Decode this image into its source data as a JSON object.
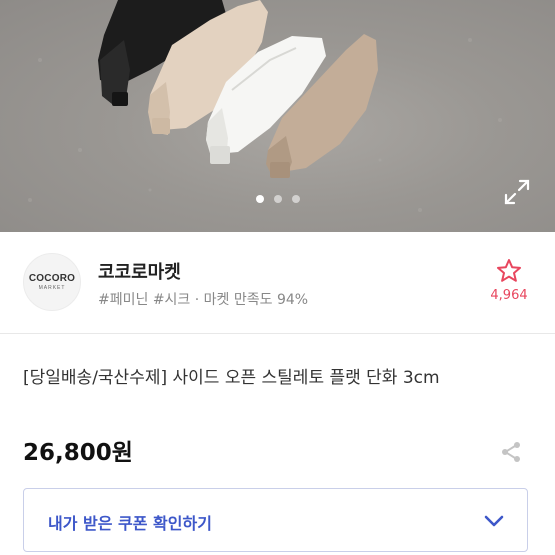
{
  "photo": {
    "carousel_total": 3,
    "carousel_active": 1
  },
  "seller": {
    "logo_line1": "COCORO",
    "logo_line2": "MARKET",
    "name": "코코로마켓",
    "tags": "#페미닌 #시크 · 마켓 만족도 94%",
    "favorite_count": "4,964"
  },
  "product": {
    "title": "[당일배송/국산수제] 사이드 오픈 스틸레토 플랫 단화 3cm",
    "price": "26,800원"
  },
  "coupon": {
    "label": "내가 받은 쿠폰 확인하기"
  },
  "colors": {
    "accent_blue": "#3d57c9",
    "favorite_pink": "#e8465e"
  },
  "icons": {
    "expand": "expand-icon",
    "favorite": "star-icon",
    "share": "share-icon",
    "chevron": "chevron-down-icon"
  }
}
